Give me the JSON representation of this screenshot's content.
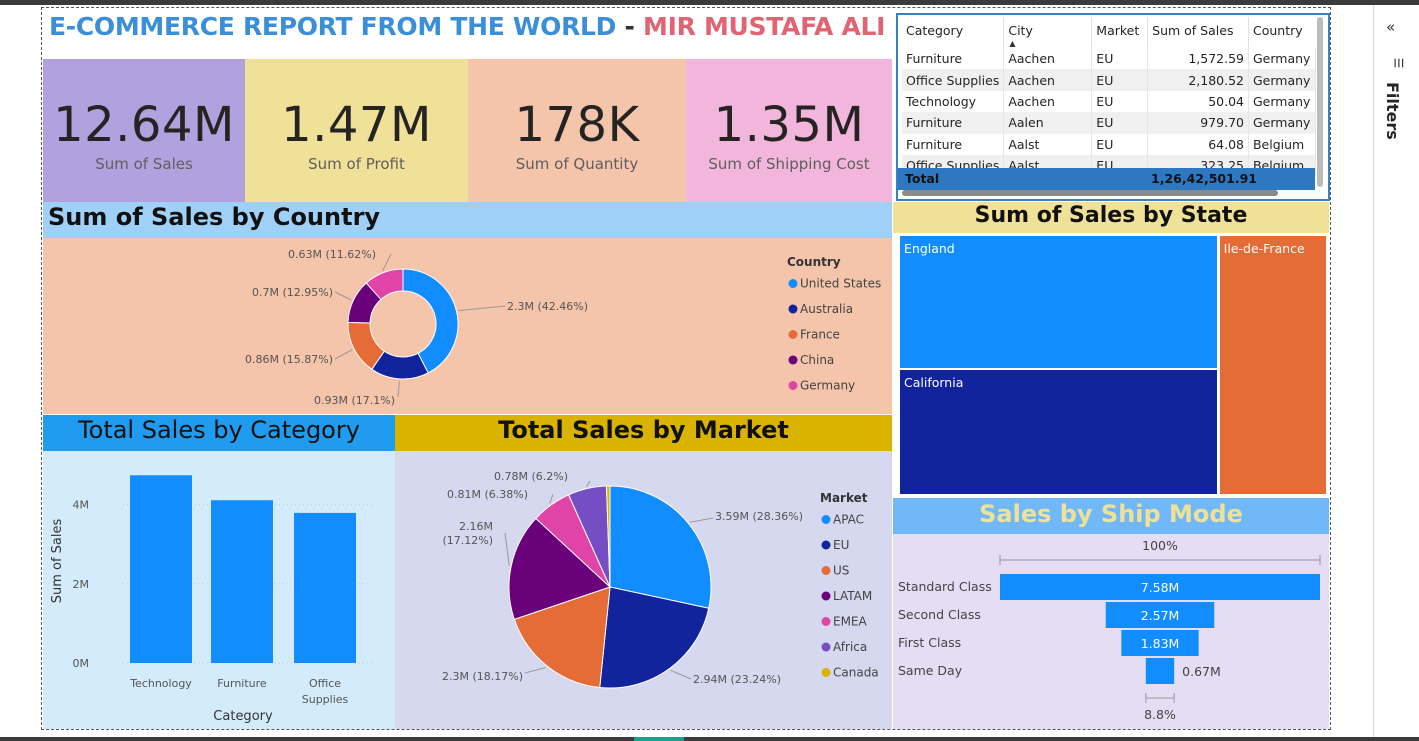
{
  "header": {
    "title_part1": "E-COMMERCE REPORT FROM THE WORLD",
    "separator": " - ",
    "title_part2": "MIR MUSTAFA ALI"
  },
  "colors": {
    "blue": "#118dff",
    "navy": "#12239e",
    "orange": "#e66c37",
    "purple": "#6b007b",
    "pink": "#e044a7",
    "violet": "#744ec2",
    "gold": "#d9b300",
    "kpi_sales_bg": "#b2a1df",
    "kpi_profit_bg": "#f0e199",
    "kpi_qty_bg": "#f4c4ab",
    "kpi_ship_bg": "#f2b6dc",
    "country_title_bg": "#9fd0f8",
    "country_body_bg": "#f4c4ab",
    "category_title_bg": "#1f9bf0",
    "category_body_bg": "#d4ebfc",
    "market_title_bg": "#d9b300",
    "market_body_bg": "#d5d8ee",
    "state_title_bg": "#f0e199",
    "ship_title_bg": "#70b8f7",
    "ship_body_bg": "#e4ddf3"
  },
  "kpis": [
    {
      "value": "12.64M",
      "label": "Sum of Sales"
    },
    {
      "value": "1.47M",
      "label": "Sum of Profit"
    },
    {
      "value": "178K",
      "label": "Sum of Quantity"
    },
    {
      "value": "1.35M",
      "label": "Sum of Shipping Cost"
    }
  ],
  "table": {
    "columns": [
      "Category",
      "City",
      "Market",
      "Sum of Sales",
      "Country"
    ],
    "rows": [
      [
        "Furniture",
        "Aachen",
        "EU",
        "1,572.59",
        "Germany"
      ],
      [
        "Office Supplies",
        "Aachen",
        "EU",
        "2,180.52",
        "Germany"
      ],
      [
        "Technology",
        "Aachen",
        "EU",
        "50.04",
        "Germany"
      ],
      [
        "Furniture",
        "Aalen",
        "EU",
        "979.70",
        "Germany"
      ],
      [
        "Furniture",
        "Aalst",
        "EU",
        "64.08",
        "Belgium"
      ],
      [
        "Office Supplies",
        "Aalst",
        "EU",
        "323.25",
        "Belgium"
      ]
    ],
    "total_label": "Total",
    "total_value": "1,26,42,501.91"
  },
  "filters": {
    "label": "Filters",
    "collapse_icon": "double-chevron-left-icon",
    "filter_icon": "filter-icon"
  },
  "charts": {
    "country": {
      "title": "Sum of Sales by Country",
      "legend_title": "Country",
      "chart_data": {
        "type": "pie",
        "variant": "donut",
        "categories": [
          "United States",
          "Australia",
          "France",
          "China",
          "Germany"
        ],
        "values": [
          2.3,
          0.93,
          0.86,
          0.7,
          0.63
        ],
        "percents": [
          42.46,
          17.1,
          15.87,
          12.95,
          11.62
        ],
        "data_labels": [
          "2.3M (42.46%)",
          "0.93M (17.1%)",
          "0.86M (15.87%)",
          "0.7M (12.95%)",
          "0.63M (11.62%)"
        ],
        "colors": [
          "#118dff",
          "#12239e",
          "#e66c37",
          "#6b007b",
          "#e044a7"
        ],
        "legend_position": "right"
      }
    },
    "category": {
      "title": "Total Sales by Category",
      "chart_data": {
        "type": "bar",
        "categories": [
          "Technology",
          "Furniture",
          "Office Supplies"
        ],
        "values": [
          4.74,
          4.11,
          3.79
        ],
        "xlabel": "Category",
        "ylabel": "Sum of Sales",
        "ylim": [
          0,
          5
        ],
        "yticks": [
          "0M",
          "2M",
          "4M"
        ],
        "ytick_values": [
          0,
          2,
          4
        ],
        "grid": true,
        "color": "#118dff"
      }
    },
    "market": {
      "title": "Total Sales by Market",
      "legend_title": "Market",
      "chart_data": {
        "type": "pie",
        "categories": [
          "APAC",
          "EU",
          "US",
          "LATAM",
          "EMEA",
          "Africa",
          "Canada"
        ],
        "values": [
          3.59,
          2.94,
          2.3,
          2.16,
          0.81,
          0.78,
          0.07
        ],
        "percents": [
          28.36,
          23.24,
          18.17,
          17.12,
          6.38,
          6.2,
          0.53
        ],
        "data_labels": [
          "3.59M (28.36%)",
          "2.94M (23.24%)",
          "2.3M (18.17%)",
          "2.16M\n(17.12%)",
          "0.81M (6.38%)",
          "0.78M (6.2%)",
          ""
        ],
        "colors": [
          "#118dff",
          "#12239e",
          "#e66c37",
          "#6b007b",
          "#e044a7",
          "#744ec2",
          "#d9b300"
        ],
        "legend_position": "right"
      }
    },
    "state": {
      "title": "Sum of Sales by State",
      "chart_data": {
        "type": "treemap",
        "categories": [
          "England",
          "California",
          "Ile-de-France"
        ],
        "values": [
          0.49,
          0.46,
          0.32
        ],
        "colors": [
          "#118dff",
          "#12239e",
          "#e66c37"
        ]
      }
    },
    "shipmode": {
      "title": "Sales by Ship Mode",
      "chart_data": {
        "type": "funnel",
        "categories": [
          "Standard Class",
          "Second Class",
          "First Class",
          "Same Day"
        ],
        "values": [
          7.58,
          2.57,
          1.83,
          0.67
        ],
        "data_labels": [
          "7.58M",
          "2.57M",
          "1.83M",
          "0.67M"
        ],
        "top_percent": "100%",
        "bottom_percent": "8.8%",
        "color": "#118dff"
      }
    }
  }
}
